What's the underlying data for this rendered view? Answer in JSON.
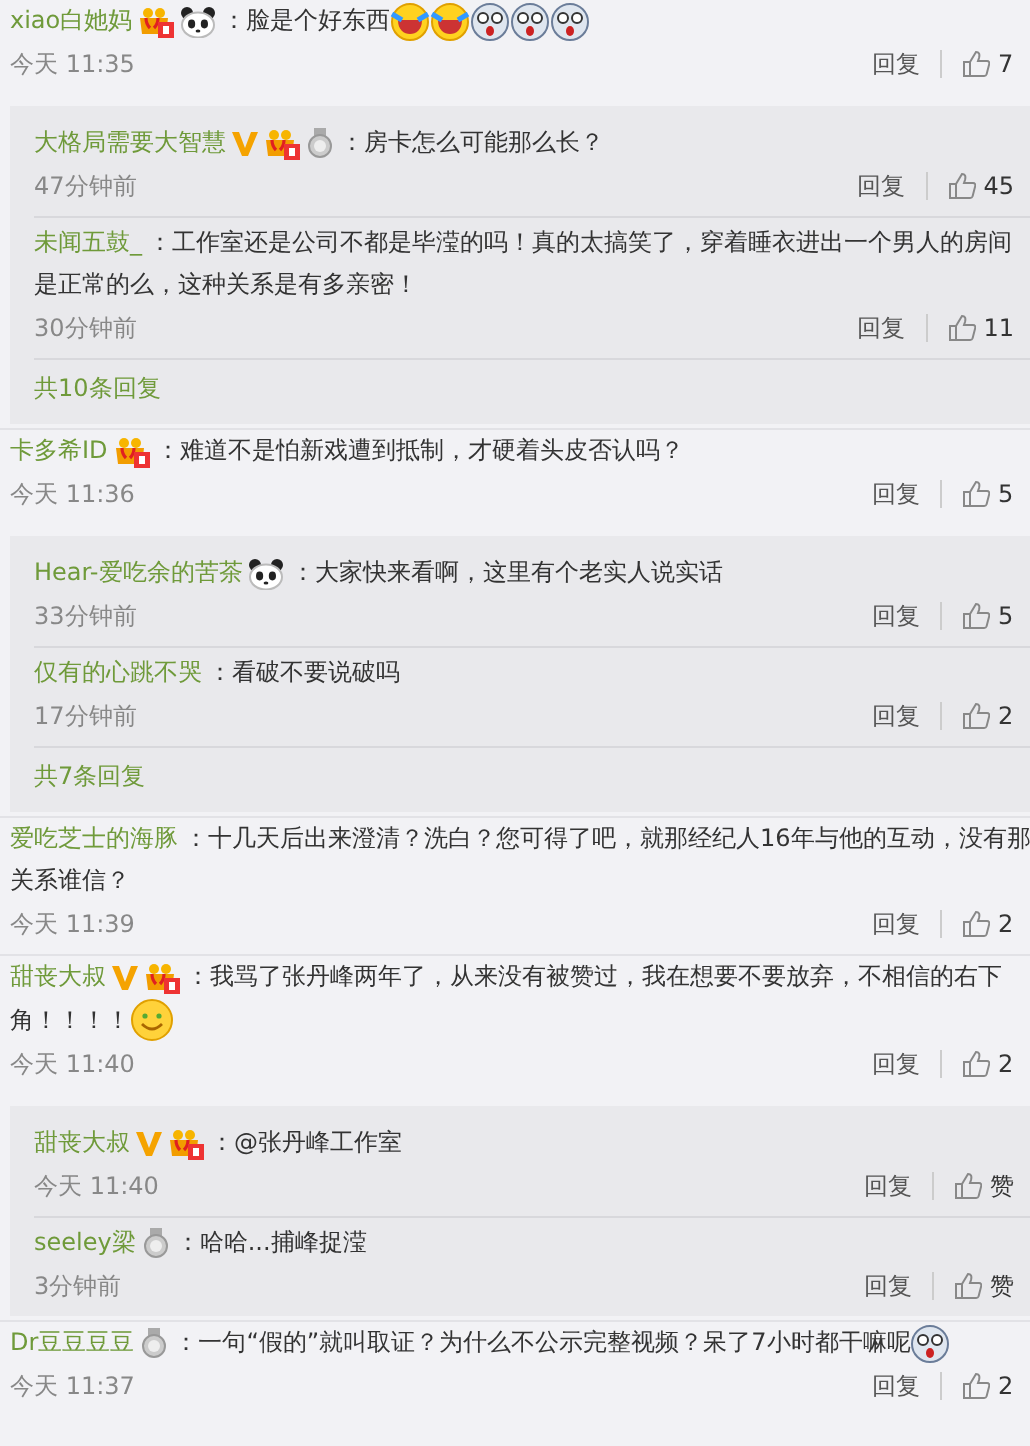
{
  "comments": [
    {
      "user": "xiao白她妈",
      "badges": [
        {
          "kind": "vip"
        },
        {
          "kind": "panda"
        }
      ],
      "lines": [
        "：脸是个好东西"
      ],
      "emojis": [
        {
          "kind": "laugh-cry"
        },
        {
          "kind": "laugh-cry"
        },
        {
          "kind": "shock"
        },
        {
          "kind": "shock"
        },
        {
          "kind": "shock"
        }
      ],
      "time": "今天 11:35",
      "reply_label": "回复",
      "likes": "7",
      "replies": [
        {
          "user": "大格局需要大智慧",
          "badges": [
            {
              "kind": "v"
            },
            {
              "kind": "vip"
            },
            {
              "kind": "medal"
            }
          ],
          "lines": [
            "：房卡怎么可能那么长？"
          ],
          "time": "47分钟前",
          "reply_label": "回复",
          "likes": "45"
        },
        {
          "user": "未闻五鼓_",
          "lines": [
            "：工作室还是公司不都是毕滢的吗！真的太搞笑了，穿着睡衣进出一个男人的房间",
            "是正常的么，这种关系是有多亲密！"
          ],
          "time": "30分钟前",
          "reply_label": "回复",
          "likes": "11"
        }
      ],
      "more": "共10条回复"
    },
    {
      "user": "卡多希ID",
      "badges": [
        {
          "kind": "vip"
        }
      ],
      "lines": [
        "：难道不是怕新戏遭到抵制，才硬着头皮否认吗？"
      ],
      "time": "今天 11:36",
      "reply_label": "回复",
      "likes": "5",
      "replies": [
        {
          "user": "Hear-爱吃余的苦茶",
          "badges": [
            {
              "kind": "panda"
            }
          ],
          "lines": [
            "：大家快来看啊，这里有个老实人说实话"
          ],
          "time": "33分钟前",
          "reply_label": "回复",
          "likes": "5"
        },
        {
          "user": "仅有的心跳不哭",
          "lines": [
            "：看破不要说破吗"
          ],
          "time": "17分钟前",
          "reply_label": "回复",
          "likes": "2"
        }
      ],
      "more": "共7条回复"
    },
    {
      "user": "爱吃芝士的海豚",
      "lines": [
        "：十几天后出来澄清？洗白？您可得了吧，就那经纪人16年与他的互动，没有那",
        "关系谁信？"
      ],
      "time": "今天 11:39",
      "reply_label": "回复",
      "likes": "2"
    },
    {
      "user": "甜丧大叔",
      "badges": [
        {
          "kind": "v"
        },
        {
          "kind": "vip"
        }
      ],
      "lines": [
        "：我骂了张丹峰两年了，从来没有被赞过，我在想要不要放弃，不相信的右下",
        "角！！！！"
      ],
      "emojis": [
        {
          "kind": "smile"
        }
      ],
      "time": "今天 11:40",
      "reply_label": "回复",
      "likes": "2",
      "replies": [
        {
          "user": "甜丧大叔",
          "badges": [
            {
              "kind": "v"
            },
            {
              "kind": "vip"
            }
          ],
          "lines": [
            "：@张丹峰工作室"
          ],
          "time": "今天 11:40",
          "reply_label": "回复",
          "likes": "赞"
        },
        {
          "user": "seeley梁",
          "badges": [
            {
              "kind": "medal"
            }
          ],
          "lines": [
            "：哈哈...捕峰捉滢"
          ],
          "time": "3分钟前",
          "reply_label": "回复",
          "likes": "赞"
        }
      ]
    },
    {
      "user": "Dr豆豆豆豆",
      "badges": [
        {
          "kind": "medal"
        }
      ],
      "lines": [
        "：一句“假的”就叫取证？为什么不公示完整视频？呆了7小时都干嘛呢"
      ],
      "emojis": [
        {
          "kind": "shock"
        }
      ],
      "time": "今天 11:37",
      "reply_label": "回复",
      "likes": "2"
    }
  ]
}
